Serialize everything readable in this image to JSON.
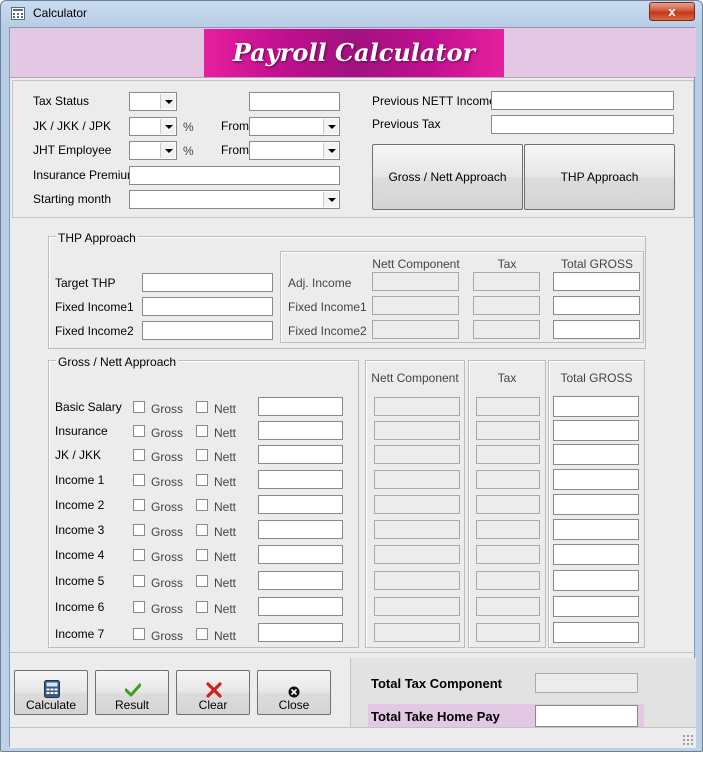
{
  "window": {
    "title": "Calculator",
    "close_symbol": "x"
  },
  "header": {
    "logo_text": "Payroll Calculator"
  },
  "top": {
    "tax_status_label": "Tax Status",
    "jk_label": "JK / JKK / JPK",
    "jht_label": "JHT Employee",
    "insurance_label": "Insurance Premium",
    "starting_month_label": "Starting month",
    "percent_symbol": "%",
    "from_label": "From",
    "prev_nett_label": "Previous NETT Income",
    "prev_tax_label": "Previous Tax Collection",
    "gross_nett_button": "Gross / Nett Approach",
    "thp_button": "THP Approach"
  },
  "thp_section": {
    "title": "THP Approach",
    "target_label": "Target THP",
    "fixed1_label": "Fixed Income1",
    "fixed2_label": "Fixed Income2",
    "columns": [
      "Nett Component",
      "Tax",
      "Total GROSS"
    ],
    "rows": [
      "Adj. Income",
      "Fixed Income1",
      "Fixed Income2"
    ]
  },
  "gross_section": {
    "title": "Gross / Nett Approach",
    "gross_label": "Gross",
    "nett_label": "Nett",
    "columns": [
      "Nett Component",
      "Tax",
      "Total GROSS"
    ],
    "rows": [
      "Basic Salary",
      "Insurance",
      "JK / JKK",
      "Income 1",
      "Income 2",
      "Income 3",
      "Income 4",
      "Income 5",
      "Income 6",
      "Income 7"
    ]
  },
  "actions": {
    "calculate": "Calculate",
    "result": "Result",
    "clear": "Clear",
    "close": "Close"
  },
  "totals": {
    "tax_component_label": "Total Tax Component",
    "take_home_label": "Total Take Home Pay"
  },
  "colors": {
    "header_band": "#e2c8e2",
    "logo_gradient": "#c21090",
    "close_button": "#c0391a"
  }
}
